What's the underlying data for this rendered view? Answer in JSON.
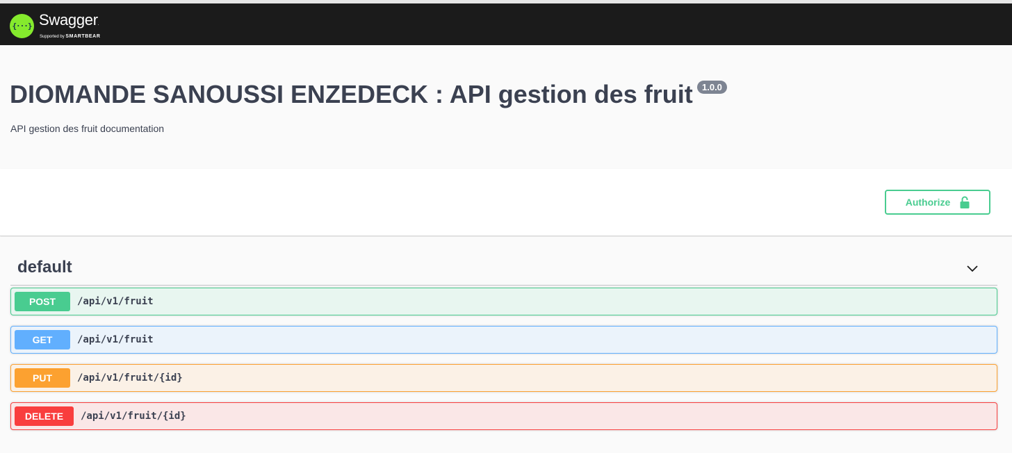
{
  "topbar": {
    "logo_icon": "{···}",
    "brand": "Swagger",
    "trademark": ".",
    "supported_by": "Supported by",
    "supporter": "SMARTBEAR"
  },
  "info": {
    "title": "DIOMANDE SANOUSSI ENZEDECK : API gestion des fruit",
    "version": "1.0.0",
    "description": "API gestion des fruit documentation"
  },
  "scheme": {
    "authorize_label": "Authorize",
    "authorize_icon": "unlocked-padlock-icon"
  },
  "tag": {
    "name": "default",
    "toggle_icon": "chevron-down-icon"
  },
  "operations": [
    {
      "method": "POST",
      "path": "/api/v1/fruit",
      "color": "#49cc90"
    },
    {
      "method": "GET",
      "path": "/api/v1/fruit",
      "color": "#61affe"
    },
    {
      "method": "PUT",
      "path": "/api/v1/fruit/{id}",
      "color": "#fca130"
    },
    {
      "method": "DELETE",
      "path": "/api/v1/fruit/{id}",
      "color": "#f93e3e"
    }
  ],
  "colors": {
    "topbar": "#1b1b1b",
    "logo_green": "#85ea2d",
    "text": "#3b4151",
    "version_badge": "#7d8492"
  }
}
